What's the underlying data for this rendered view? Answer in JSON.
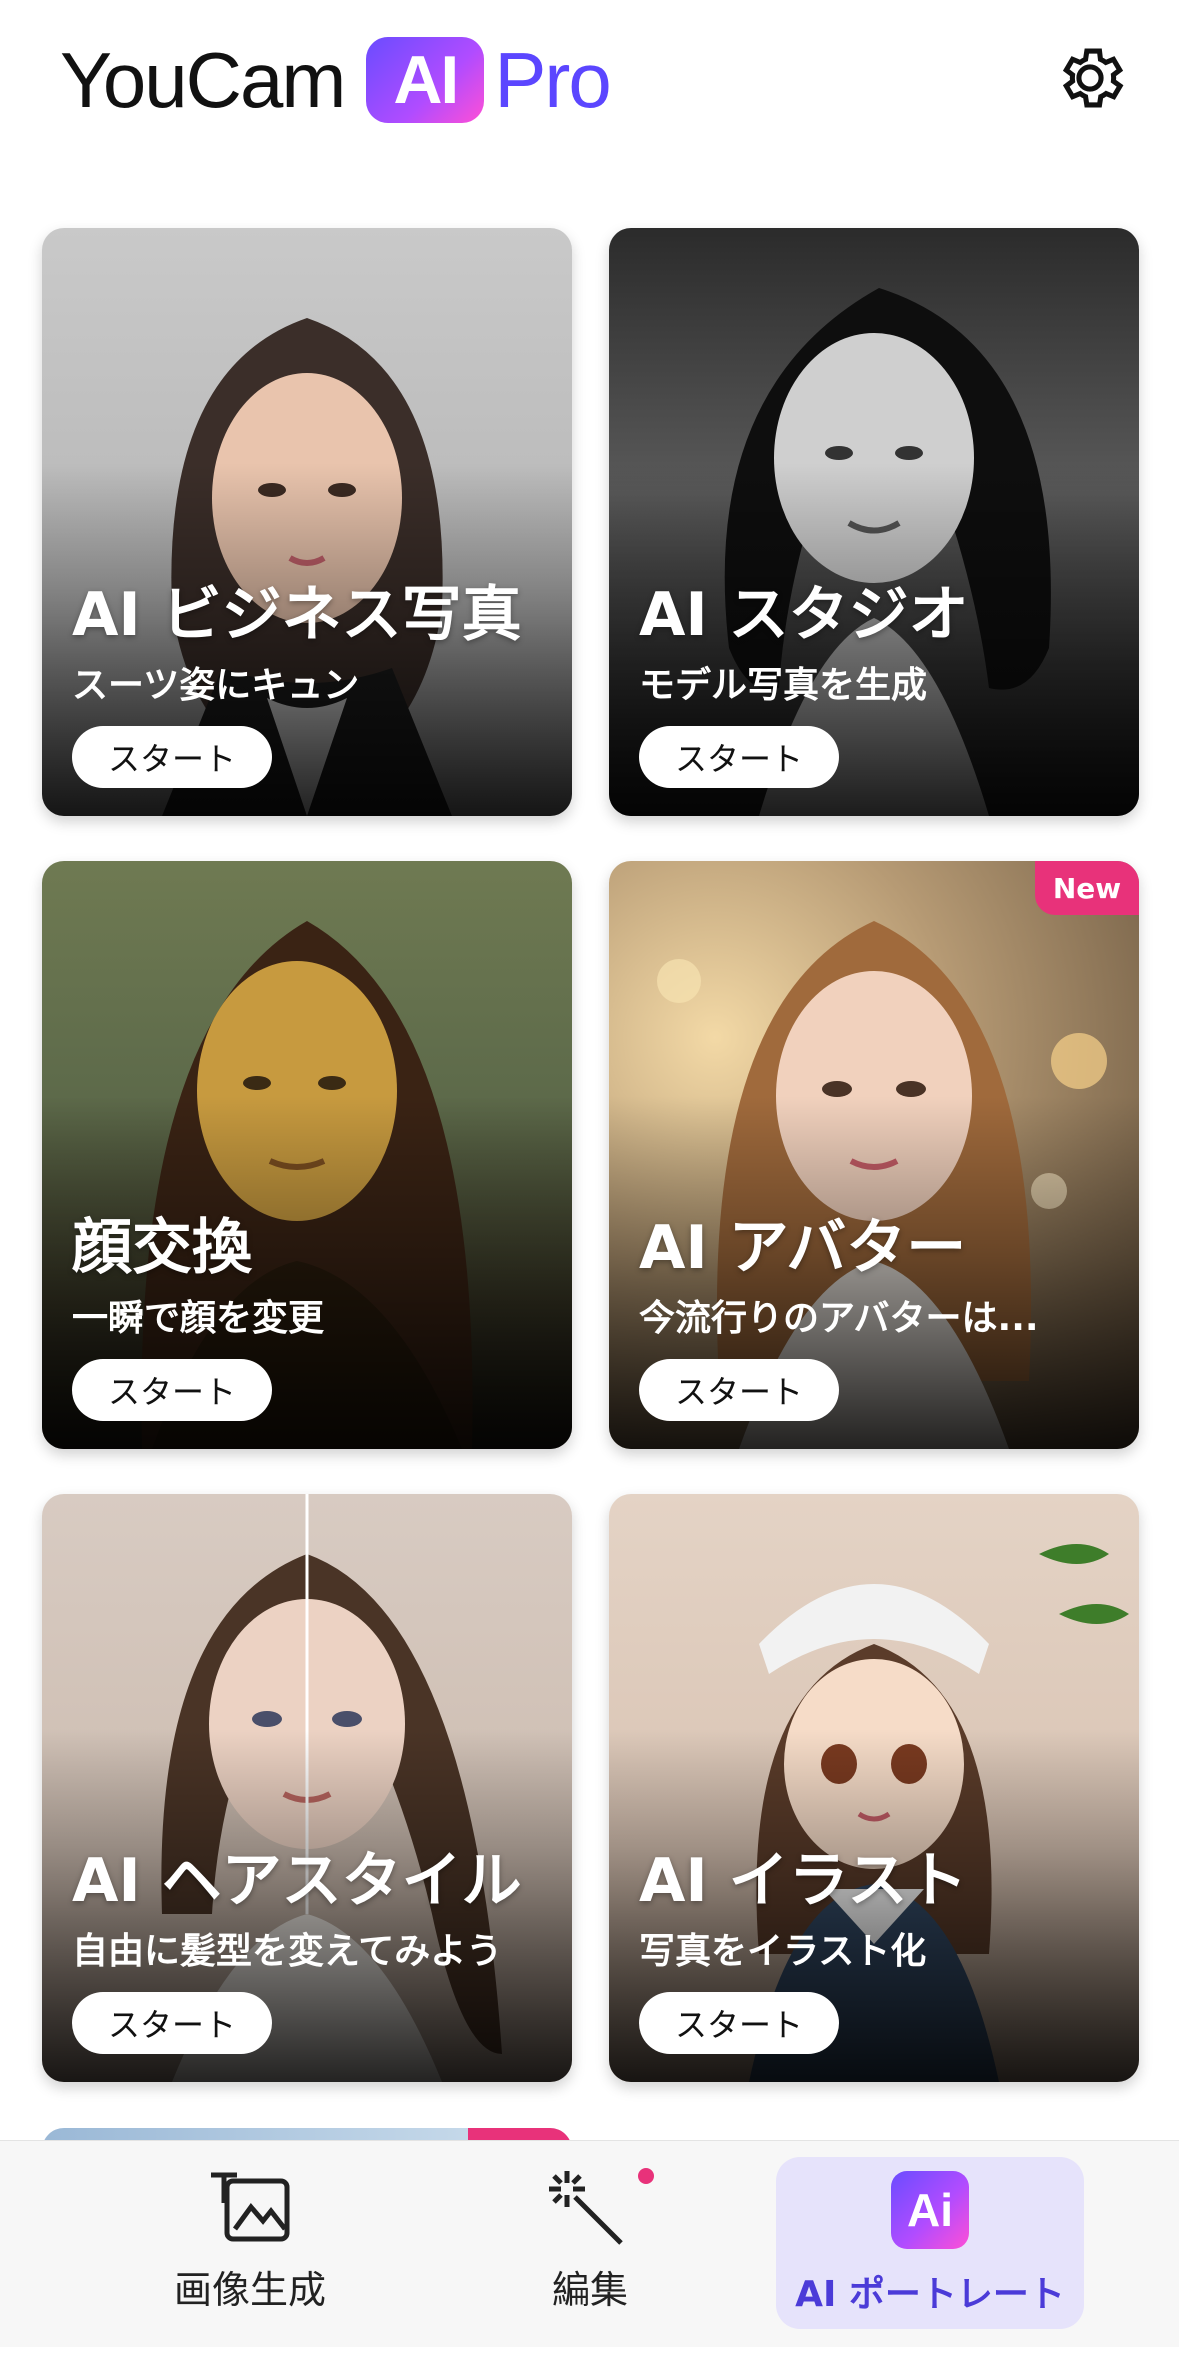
{
  "header": {
    "logo_word": "YouCam",
    "logo_ai": "AI",
    "logo_pro": "Pro",
    "settings_icon": "gear-icon"
  },
  "cards": [
    {
      "title": "AI ビジネス写真",
      "subtitle": "スーツ姿にキュン",
      "button": "スタート",
      "badge": ""
    },
    {
      "title": "AI スタジオ",
      "subtitle": "モデル写真を生成",
      "button": "スタート",
      "badge": ""
    },
    {
      "title": "顔交換",
      "subtitle": "一瞬で顔を変更",
      "button": "スタート",
      "badge": ""
    },
    {
      "title": "AI アバター",
      "subtitle": "今流行りのアバターは...",
      "button": "スタート",
      "badge": "New"
    },
    {
      "title": "AI ヘアスタイル",
      "subtitle": "自由に髪型を変えてみよう",
      "button": "スタート",
      "badge": ""
    },
    {
      "title": "AI イラスト",
      "subtitle": "写真をイラスト化",
      "button": "スタート",
      "badge": ""
    }
  ],
  "bottom_nav": {
    "items": [
      {
        "label": "画像生成",
        "icon": "image-generate-icon",
        "active": false
      },
      {
        "label": "編集",
        "icon": "magic-wand-icon",
        "active": false,
        "notification_dot": true
      },
      {
        "label": "AI ポートレート",
        "icon": "ai-portrait-icon",
        "icon_text": "Ai",
        "active": true
      }
    ]
  },
  "colors": {
    "accent": "#5b46ff",
    "badge": "#e8327a",
    "active_nav_bg": "#e6e3fb"
  }
}
